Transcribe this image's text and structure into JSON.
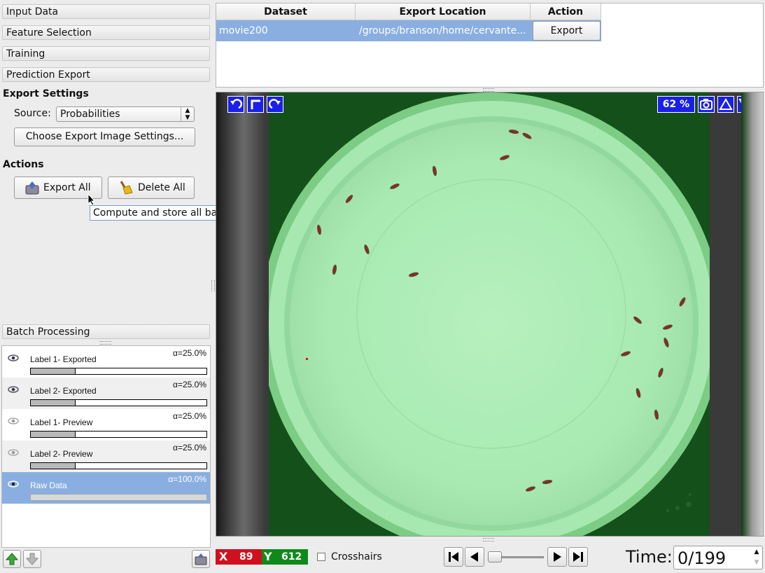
{
  "left_panel": {
    "accordion": {
      "input_data": "Input Data",
      "feature_selection": "Feature Selection",
      "training": "Training",
      "prediction_export": "Prediction Export",
      "batch_processing": "Batch Processing"
    },
    "export_settings": {
      "title": "Export Settings",
      "source_label": "Source:",
      "source_value": "Probabilities",
      "choose_button": "Choose Export Image Settings..."
    },
    "actions": {
      "title": "Actions",
      "export_all": "Export All",
      "delete_all": "Delete All",
      "tooltip": "Compute and store all batch output datasets"
    },
    "layers": [
      {
        "name": "Label 1- Exported",
        "alpha": "α=25.0%",
        "opacity": 0.25,
        "visible": true
      },
      {
        "name": "Label 2- Exported",
        "alpha": "α=25.0%",
        "opacity": 0.25,
        "visible": true
      },
      {
        "name": "Label 1- Preview",
        "alpha": "α=25.0%",
        "opacity": 0.25,
        "visible": false
      },
      {
        "name": "Label 2- Preview",
        "alpha": "α=25.0%",
        "opacity": 0.25,
        "visible": false
      },
      {
        "name": "Raw Data",
        "alpha": "α=100.0%",
        "opacity": 1.0,
        "visible": true,
        "selected": true
      }
    ]
  },
  "table": {
    "headers": [
      "Dataset",
      "Export Location",
      "Action"
    ],
    "rows": [
      {
        "dataset": "movie200",
        "location": "/groups/branson/home/cervante...",
        "action": "Export"
      }
    ]
  },
  "viewer": {
    "zoom": "62 %"
  },
  "status": {
    "x_label": "X",
    "x_value": "89",
    "y_label": "Y",
    "y_value": "612",
    "crosshairs": "Crosshairs",
    "time_label": "Time:",
    "time_value": "0/199"
  },
  "colors": {
    "selection": "#8aaee0",
    "overlay_green": "#a8e8b0",
    "x_badge": "#d0101e",
    "y_badge": "#0f8a1a",
    "viewer_button": "#1a20e8"
  }
}
